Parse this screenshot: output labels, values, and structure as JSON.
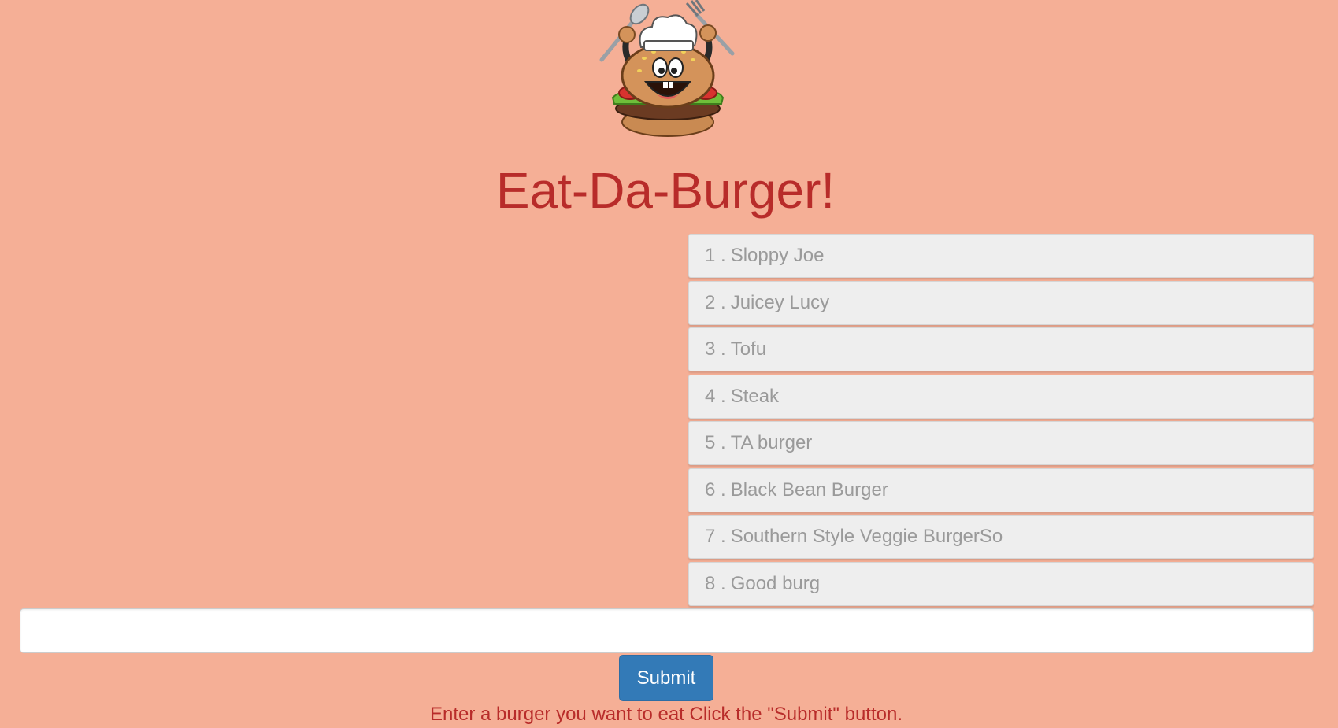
{
  "header": {
    "logo_description": "cartoon burger chef holding fork and spoon",
    "title": "Eat-Da-Burger!"
  },
  "burgers": [
    {
      "number": "1 .",
      "name": "Sloppy Joe"
    },
    {
      "number": "2 .",
      "name": "Juicey Lucy"
    },
    {
      "number": "3 .",
      "name": "Tofu"
    },
    {
      "number": "4 .",
      "name": "Steak"
    },
    {
      "number": "5 .",
      "name": "TA burger"
    },
    {
      "number": "6 .",
      "name": "Black Bean Burger"
    },
    {
      "number": "7 .",
      "name": "Southern Style Veggie BurgerSo"
    },
    {
      "number": "8 .",
      "name": "Good burg"
    }
  ],
  "form": {
    "input_value": "",
    "input_placeholder": "",
    "submit_label": "Submit",
    "instructions": "Enter a burger you want to eat Click the \"Submit\" button."
  },
  "colors": {
    "background": "#f5af96",
    "title": "#b82c2a",
    "button": "#337ab7"
  }
}
